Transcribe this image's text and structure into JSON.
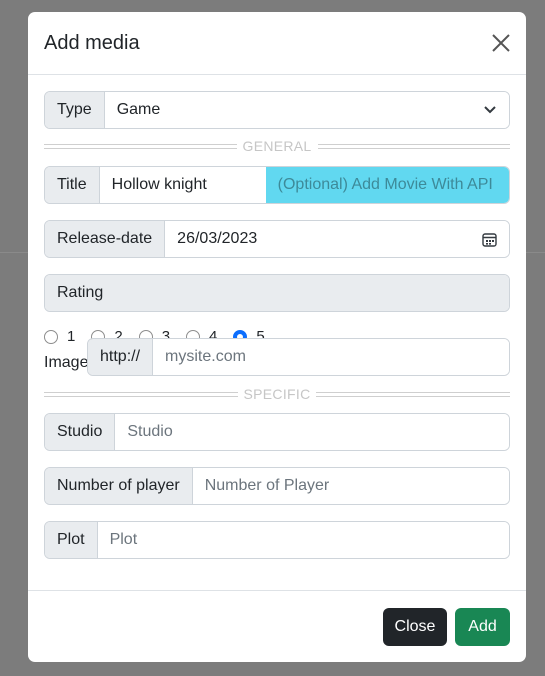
{
  "modal": {
    "title": "Add media",
    "close_icon": "close-icon"
  },
  "type_field": {
    "label": "Type",
    "value": "Game",
    "icon": "chevron-down-icon"
  },
  "separators": {
    "general": "GENERAL",
    "specific": "SPECIFIC"
  },
  "title_field": {
    "label": "Title",
    "value": "Hollow knight",
    "api_button": "(Optional) Add Movie With API"
  },
  "release_field": {
    "label": "Release-date",
    "value": "26/03/2023",
    "icon": "calendar-icon"
  },
  "rating": {
    "label": "Rating",
    "options": [
      "1",
      "2",
      "3",
      "4",
      "5"
    ],
    "selected": "5"
  },
  "image_field": {
    "label": "Image",
    "prefix": "http://",
    "placeholder": "mysite.com"
  },
  "studio_field": {
    "label": "Studio",
    "placeholder": "Studio"
  },
  "players_field": {
    "label": "Number of player",
    "placeholder": "Number of Player"
  },
  "plot_field": {
    "label": "Plot",
    "placeholder": "Plot"
  },
  "footer": {
    "close_label": "Close",
    "add_label": "Add"
  },
  "colors": {
    "primary": "#0d6efd",
    "success": "#198754",
    "dark": "#212529",
    "info": "#61d8f0"
  }
}
